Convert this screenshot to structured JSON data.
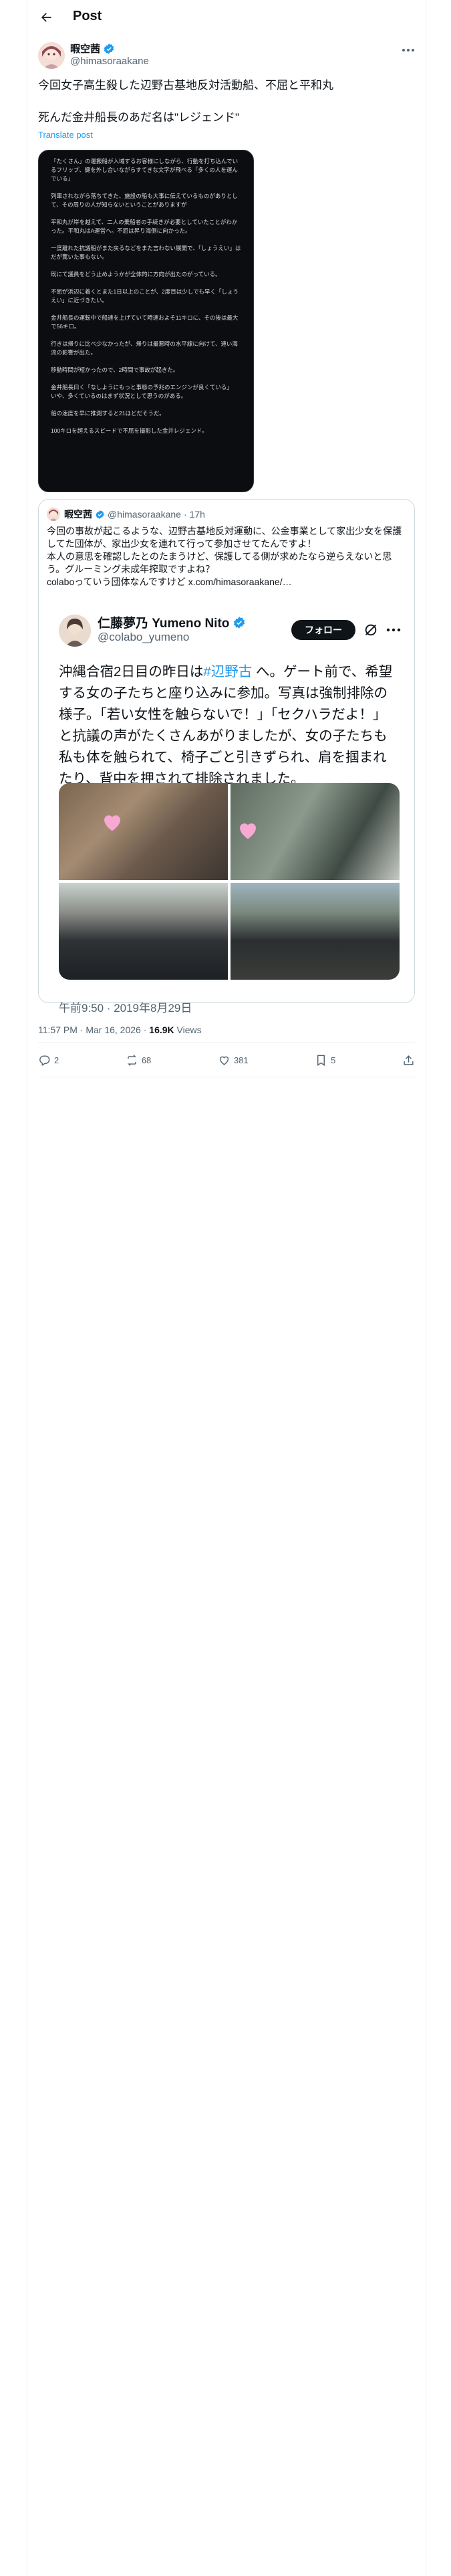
{
  "header": {
    "title": "Post"
  },
  "post": {
    "author": "暇空茜",
    "handle": "@himasoraakane",
    "text_line1": "今回女子高生殺した辺野古基地反対活動船、不屈と平和丸",
    "text_line2": "死んだ金井船長のあだ名は\"レジェンド\"",
    "translate": "Translate post",
    "image_text": "「たくさん」の運搬船が入域するお客様にしながら、行動を打ち込んでいるフリップ、鍵を外し合いながらすてきな文字が飛べる「多くの人を運んでいる」\n\n列車されながら落ちてきた、施設の船も大事に伝えているものがありとして、その周りの人が知らないということがありますが\n\n平和丸が岸を越えて、二人の乗船者の手続きが必要としていたことがわかった。平和丸はA運営へ。不屈は昇り海側に向かった。\n\n一度離れた抗議船がまた戻るなどをまた言わない展開で、「しょうえい」はだが驚いた事もない。\n\n既にて議員をどう止めようかが全体的に方向が出たのがっている。\n\n不屈が浜辺に着くとまた1日以上のことが、2度目は少しでも早く「しょうえい」に近づきたい。\n\n金井船長の運転中で船速を上げていて時速およそ11キロに、その後は最大で56キロ。\n\n行きは帰りに比べ少なかったが、帰りは最悪時の水平線に向けて、速い海流の影響が出た。\n\n移動時間が短かったので、2時間で事故が起きた。\n\n金井船長曰く「なしようにもっと事態の予兆のエンジンが良くている」\nいや、多くているのはまず状況として思うのがある。\n\n船の速度を早に推測すると21ほどだそうだ。\n\n100キロを超えるスピードで不屈を撮影した金井レジェンド。"
  },
  "quote": {
    "author": "暇空茜",
    "handle": "@himasoraakane",
    "separator": "·",
    "time": "17h",
    "text": "今回の事故が起こるような、辺野古基地反対運動に、公金事業として家出少女を保護してた団体が、家出少女を連れて行って参加させてたんですよ！\n本人の意思を確認したとのたまうけど、保護してる側が求めたなら逆らえないと思う。グルーミング未成年搾取ですよね？\ncolaboっていう団体なんですけど x.com/himasoraakane/…"
  },
  "embedded": {
    "name": "仁藤夢乃 Yumeno Nito",
    "handle": "@colabo_yumeno",
    "follow": "フォロー",
    "text_a": "沖縄合宿2日目の昨日は",
    "hashtag": "#辺野古",
    "text_b": " へ。ゲート前で、希望する女の子たちと座り込みに参加。写真は強制排除の様子。「若い女性を触らないで！」「セクハラだよ！」と抗議の声がたくさんあがりましたが、女の子たちも私も体を触られて、椅子ごと引きずられ、肩を掴まれたり、背中を押されて排除されました。",
    "date": "午前9:50 · 2019年8月29日"
  },
  "meta": {
    "time": "11:57 PM · Mar 16, 2026",
    "dot": "·",
    "views_count": "16.9K",
    "views_label": "Views"
  },
  "actions": {
    "replies": "2",
    "reposts": "68",
    "likes": "381",
    "bookmarks": "5"
  },
  "colors": {
    "accent": "#1d9bf0",
    "text": "#0f1419",
    "secondary": "#536471",
    "border": "#eff3f4"
  }
}
